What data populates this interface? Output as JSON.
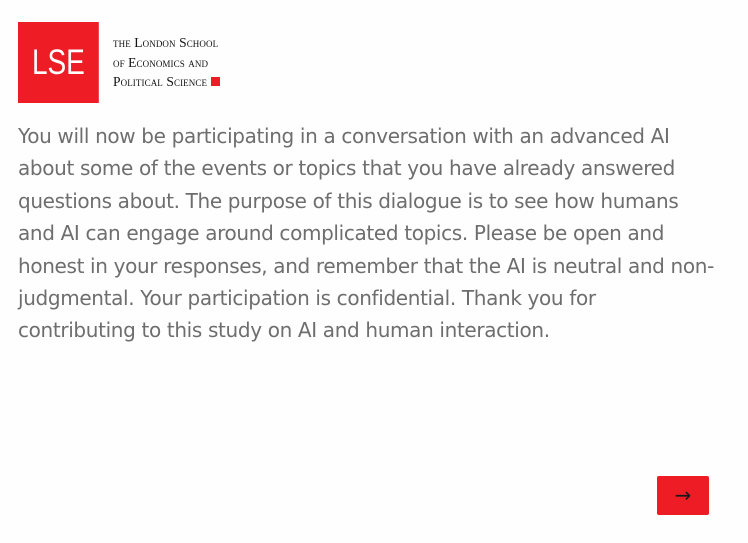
{
  "logo": {
    "mark": "LSE",
    "name_lines": [
      "the London School",
      "of Economics and",
      "Political Science"
    ],
    "accent_color": "#ee1c25"
  },
  "intro": {
    "text": "You will now be participating in a conversation with an advanced AI about some of the events or topics that you have already answered questions about. The purpose of this dialogue is to see how humans and AI can engage around complicated topics. Please be open and honest in your responses, and remember that the AI is neutral and non-judgmental. Your participation is confidential. Thank you for contributing to this study on AI and human interaction."
  },
  "navigation": {
    "next_label": "→",
    "next_icon": "arrow-right-icon",
    "button_color": "#ee1c25"
  }
}
